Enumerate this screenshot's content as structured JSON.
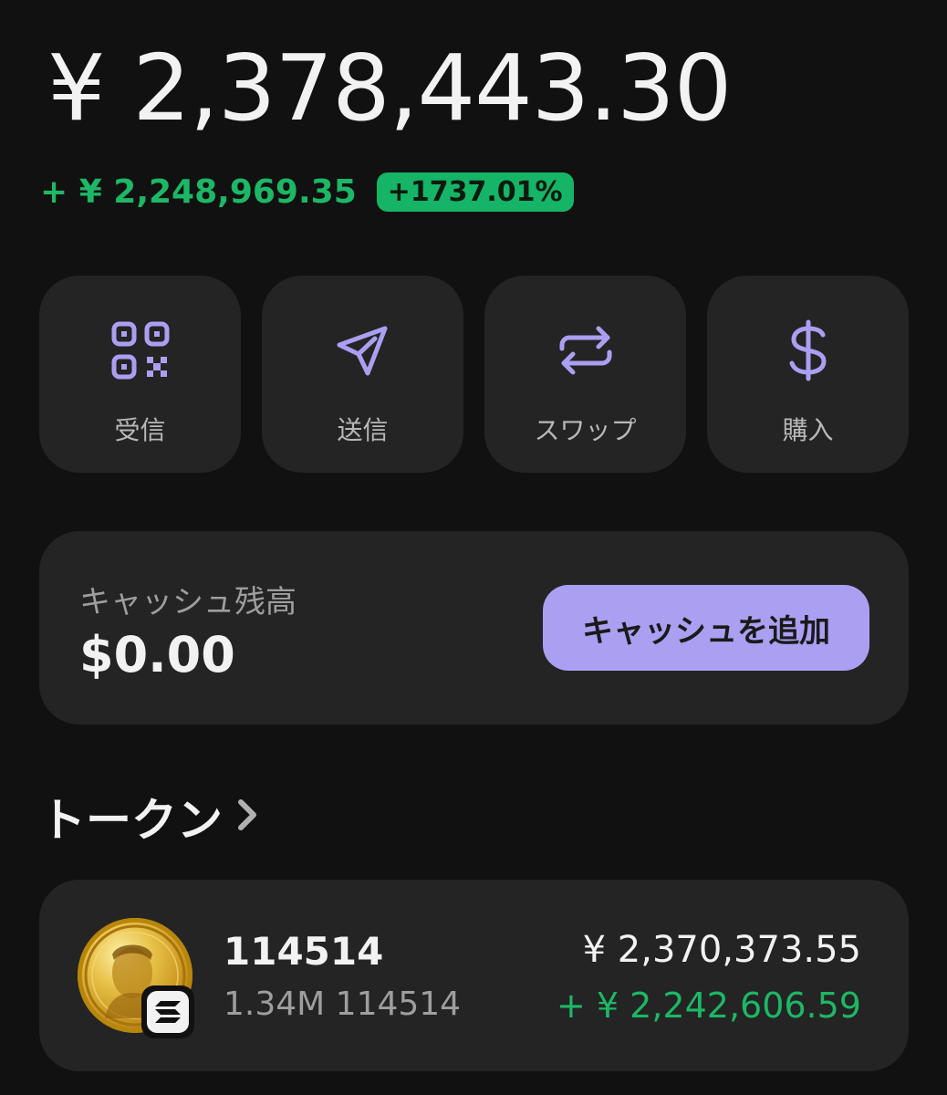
{
  "balance": {
    "total": "¥ 2,378,443.30",
    "change_amount": "+ ¥ 2,248,969.35",
    "change_percent": "+1737.01%"
  },
  "actions": [
    {
      "label": "受信",
      "icon": "qr-code-icon"
    },
    {
      "label": "送信",
      "icon": "send-icon"
    },
    {
      "label": "スワップ",
      "icon": "swap-icon"
    },
    {
      "label": "購入",
      "icon": "dollar-icon"
    }
  ],
  "cash": {
    "label": "キャッシュ残高",
    "value": "$0.00",
    "add_button_label": "キャッシュを追加"
  },
  "tokens_section": {
    "title": "トークン",
    "icon": "chevron-right-icon"
  },
  "tokens": [
    {
      "name": "114514",
      "amount": "1.34M 114514",
      "value": "¥ 2,370,373.55",
      "change": "+ ¥ 2,242,606.59",
      "icon": "gold-coin-token-icon",
      "chain_icon": "solana-icon"
    }
  ],
  "colors": {
    "background": "#111111",
    "card": "#242424",
    "accent": "#ab9ff2",
    "positive": "#1db766",
    "positive_badge": "#16b466"
  }
}
